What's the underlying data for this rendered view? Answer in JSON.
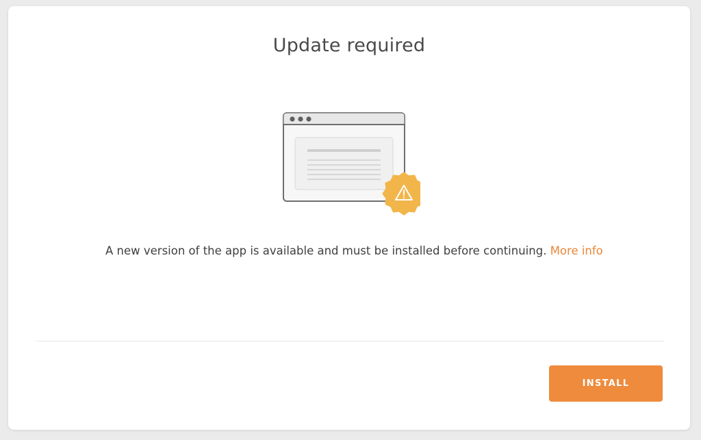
{
  "dialog": {
    "title": "Update required",
    "message": "A new version of the app is available and must be installed before continuing.",
    "more_info_label": "More info",
    "install_label": "INSTALL"
  },
  "illustration": {
    "window_icon": "browser-window-icon",
    "badge_icon": "warning-icon"
  },
  "colors": {
    "accent": "#ee8b3d",
    "badge": "#f2b54a",
    "link": "#e8873a",
    "title_text": "#4a4a4a",
    "body_text": "#3f3f3f"
  }
}
